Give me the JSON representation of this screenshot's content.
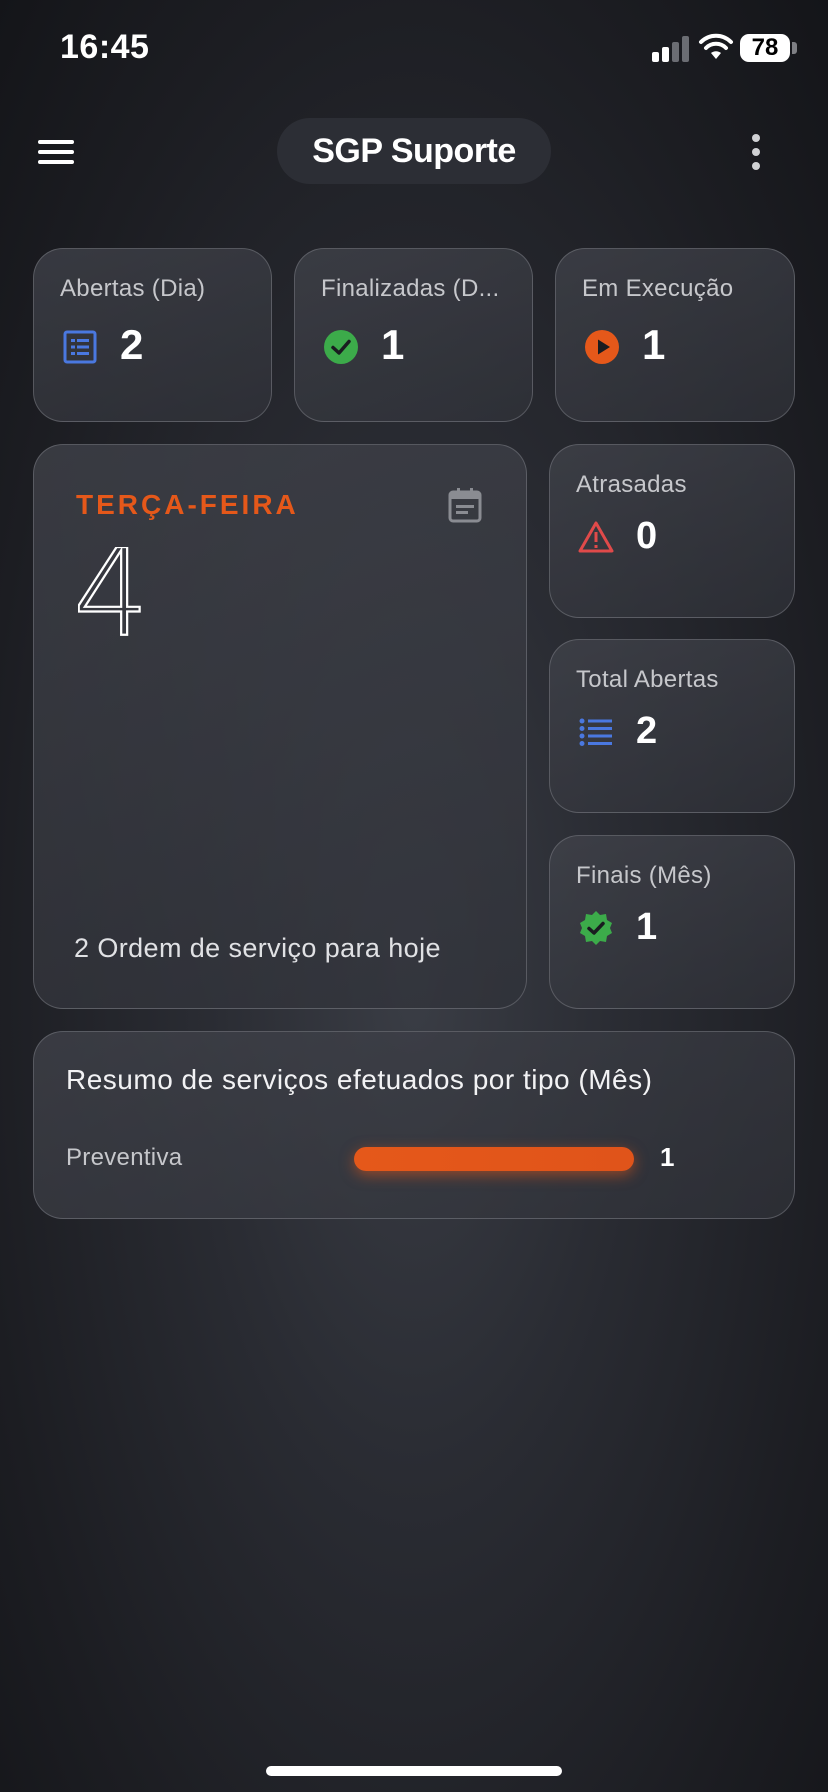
{
  "status_bar": {
    "time": "16:45",
    "battery": "78",
    "icons": [
      "signal-icon",
      "wifi-icon",
      "battery-icon"
    ]
  },
  "header": {
    "title": "SGP Suporte",
    "icons": [
      "menu-icon",
      "more-vertical-icon"
    ]
  },
  "stats": {
    "abertas_dia": {
      "label": "Abertas (Dia)",
      "value": "2",
      "icon": "list-icon",
      "color": "#4a78e0"
    },
    "finalizadas_dia": {
      "label": "Finalizadas (D...",
      "value": "1",
      "icon": "check-circle-icon",
      "color": "#3cab4a"
    },
    "em_execucao": {
      "label": "Em Execução",
      "value": "1",
      "icon": "play-circle-icon",
      "color": "#e5581a"
    },
    "atrasadas": {
      "label": "Atrasadas",
      "value": "0",
      "icon": "warning-icon",
      "color": "#e04a4a"
    },
    "total_abertas": {
      "label": "Total Abertas",
      "value": "2",
      "icon": "list-bullets-icon",
      "color": "#4a78e0"
    },
    "finais_mes": {
      "label": "Finais (Mês)",
      "value": "1",
      "icon": "verified-badge-icon",
      "color": "#3cab4a"
    }
  },
  "day_card": {
    "weekday": "TERÇA-FEIRA",
    "day": "4",
    "subtitle": "2 Ordem de serviço para hoje",
    "icon": "calendar-icon",
    "accent": "#e5581a"
  },
  "summary": {
    "title": "Resumo de serviços efetuados por tipo (Mês)",
    "items": [
      {
        "label": "Preventiva",
        "value": "1",
        "fraction": 1.0,
        "color": "#e5581a"
      }
    ]
  }
}
